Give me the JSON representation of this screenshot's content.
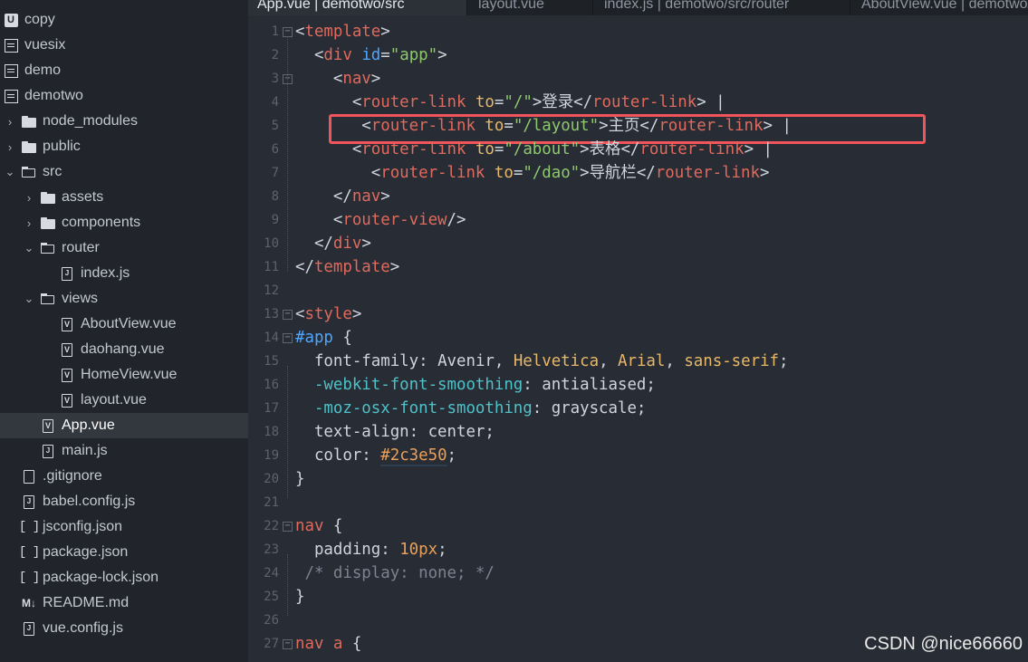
{
  "sidebar": {
    "items": [
      {
        "label": "copy",
        "icon": "project-u-icon",
        "indent": 0,
        "chevron": ""
      },
      {
        "label": "vuesix",
        "icon": "project-icon",
        "indent": 0,
        "chevron": ""
      },
      {
        "label": "demo",
        "icon": "project-icon",
        "indent": 0,
        "chevron": ""
      },
      {
        "label": "demotwo",
        "icon": "project-icon",
        "indent": 0,
        "chevron": ""
      },
      {
        "label": "node_modules",
        "icon": "folder-icon",
        "indent": 1,
        "chevron": "›"
      },
      {
        "label": "public",
        "icon": "folder-icon",
        "indent": 1,
        "chevron": "›"
      },
      {
        "label": "src",
        "icon": "folder-open-icon",
        "indent": 1,
        "chevron": "⌄"
      },
      {
        "label": "assets",
        "icon": "folder-icon",
        "indent": 2,
        "chevron": "›"
      },
      {
        "label": "components",
        "icon": "folder-icon",
        "indent": 2,
        "chevron": "›"
      },
      {
        "label": "router",
        "icon": "folder-open-icon",
        "indent": 2,
        "chevron": "⌄"
      },
      {
        "label": "index.js",
        "icon": "js-file-icon",
        "indent": 3,
        "chevron": ""
      },
      {
        "label": "views",
        "icon": "folder-open-icon",
        "indent": 2,
        "chevron": "⌄"
      },
      {
        "label": "AboutView.vue",
        "icon": "vue-file-icon",
        "indent": 3,
        "chevron": ""
      },
      {
        "label": "daohang.vue",
        "icon": "vue-file-icon",
        "indent": 3,
        "chevron": ""
      },
      {
        "label": "HomeView.vue",
        "icon": "vue-file-icon",
        "indent": 3,
        "chevron": ""
      },
      {
        "label": "layout.vue",
        "icon": "vue-file-icon",
        "indent": 3,
        "chevron": ""
      },
      {
        "label": "App.vue",
        "icon": "vue-file-icon",
        "indent": 2,
        "chevron": "",
        "selected": true
      },
      {
        "label": "main.js",
        "icon": "js-file-icon",
        "indent": 2,
        "chevron": ""
      },
      {
        "label": ".gitignore",
        "icon": "file-icon",
        "indent": 1,
        "chevron": ""
      },
      {
        "label": "babel.config.js",
        "icon": "js-file-icon",
        "indent": 1,
        "chevron": ""
      },
      {
        "label": "jsconfig.json",
        "icon": "json-file-icon",
        "indent": 1,
        "chevron": ""
      },
      {
        "label": "package.json",
        "icon": "json-file-icon",
        "indent": 1,
        "chevron": ""
      },
      {
        "label": "package-lock.json",
        "icon": "json-file-icon",
        "indent": 1,
        "chevron": ""
      },
      {
        "label": "README.md",
        "icon": "markdown-file-icon",
        "indent": 1,
        "chevron": ""
      },
      {
        "label": "vue.config.js",
        "icon": "js-file-icon",
        "indent": 1,
        "chevron": ""
      }
    ]
  },
  "tabs": [
    {
      "label": "App.vue | demotwo/src",
      "active": true
    },
    {
      "label": "layout.vue",
      "active": false
    },
    {
      "label": "index.js | demotwo/src/router",
      "active": false
    },
    {
      "label": "AboutView.vue | demotwo/src/views",
      "active": false
    }
  ],
  "editor": {
    "lines": [
      {
        "n": "1",
        "fold": "⊟",
        "tokens": [
          [
            "t-pun",
            "<"
          ],
          [
            "t-tag",
            "template"
          ],
          [
            "t-pun",
            ">"
          ]
        ]
      },
      {
        "n": "2",
        "fold": "",
        "tokens": [
          [
            "t-pun",
            "  <"
          ],
          [
            "t-tag",
            "div"
          ],
          [
            "t-pun",
            " "
          ],
          [
            "t-id",
            "id"
          ],
          [
            "t-pun",
            "="
          ],
          [
            "t-str",
            "\"app\""
          ],
          [
            "t-pun",
            ">"
          ]
        ]
      },
      {
        "n": "3",
        "fold": "⊟",
        "tokens": [
          [
            "t-pun",
            "    <"
          ],
          [
            "t-tag",
            "nav"
          ],
          [
            "t-pun",
            ">"
          ]
        ]
      },
      {
        "n": "4",
        "fold": "",
        "tokens": [
          [
            "t-pun",
            "      <"
          ],
          [
            "t-tag",
            "router-link"
          ],
          [
            "t-pun",
            " "
          ],
          [
            "t-attr",
            "to"
          ],
          [
            "t-pun",
            "="
          ],
          [
            "t-str",
            "\"/\""
          ],
          [
            "t-pun",
            ">"
          ],
          [
            "t-txt",
            "登录"
          ],
          [
            "t-pun",
            "</"
          ],
          [
            "t-tag",
            "router-link"
          ],
          [
            "t-pun",
            "> |"
          ]
        ]
      },
      {
        "n": "5",
        "fold": "",
        "tokens": [
          [
            "t-pun",
            "       <"
          ],
          [
            "t-tag",
            "router-link"
          ],
          [
            "t-pun",
            " "
          ],
          [
            "t-attr",
            "to"
          ],
          [
            "t-pun",
            "="
          ],
          [
            "t-str",
            "\"/layout\""
          ],
          [
            "t-pun",
            ">"
          ],
          [
            "t-txt",
            "主页"
          ],
          [
            "t-pun",
            "</"
          ],
          [
            "t-tag",
            "router-link"
          ],
          [
            "t-pun",
            "> |"
          ]
        ]
      },
      {
        "n": "6",
        "fold": "",
        "tokens": [
          [
            "t-pun",
            "      <"
          ],
          [
            "t-tag",
            "router-link"
          ],
          [
            "t-pun",
            " "
          ],
          [
            "t-attr",
            "to"
          ],
          [
            "t-pun",
            "="
          ],
          [
            "t-str",
            "\"/about\""
          ],
          [
            "t-pun",
            ">"
          ],
          [
            "t-txt",
            "表格"
          ],
          [
            "t-pun",
            "</"
          ],
          [
            "t-tag",
            "router-link"
          ],
          [
            "t-pun",
            "> |"
          ]
        ]
      },
      {
        "n": "7",
        "fold": "",
        "tokens": [
          [
            "t-pun",
            "        <"
          ],
          [
            "t-tag",
            "router-link"
          ],
          [
            "t-pun",
            " "
          ],
          [
            "t-attr",
            "to"
          ],
          [
            "t-pun",
            "="
          ],
          [
            "t-str",
            "\"/dao\""
          ],
          [
            "t-pun",
            ">"
          ],
          [
            "t-txt",
            "导航栏"
          ],
          [
            "t-pun",
            "</"
          ],
          [
            "t-tag",
            "router-link"
          ],
          [
            "t-pun",
            ">"
          ]
        ]
      },
      {
        "n": "8",
        "fold": "",
        "tokens": [
          [
            "t-pun",
            "    </"
          ],
          [
            "t-tag",
            "nav"
          ],
          [
            "t-pun",
            ">"
          ]
        ]
      },
      {
        "n": "9",
        "fold": "",
        "tokens": [
          [
            "t-pun",
            "    <"
          ],
          [
            "t-tag",
            "router-view"
          ],
          [
            "t-pun",
            "/>"
          ]
        ]
      },
      {
        "n": "10",
        "fold": "",
        "tokens": [
          [
            "t-pun",
            "  </"
          ],
          [
            "t-tag",
            "div"
          ],
          [
            "t-pun",
            ">"
          ]
        ]
      },
      {
        "n": "11",
        "fold": "",
        "tokens": [
          [
            "t-pun",
            "</"
          ],
          [
            "t-tag",
            "template"
          ],
          [
            "t-pun",
            ">"
          ]
        ]
      },
      {
        "n": "12",
        "fold": "",
        "tokens": []
      },
      {
        "n": "13",
        "fold": "⊟",
        "tokens": [
          [
            "t-pun",
            "<"
          ],
          [
            "t-tag",
            "style"
          ],
          [
            "t-pun",
            ">"
          ]
        ]
      },
      {
        "n": "14",
        "fold": "⊟",
        "tokens": [
          [
            "t-id",
            "#app"
          ],
          [
            "t-pun",
            " {"
          ]
        ]
      },
      {
        "n": "15",
        "fold": "",
        "tokens": [
          [
            "t-prop",
            "  font-family"
          ],
          [
            "t-pun",
            ": Avenir, "
          ],
          [
            "t-kw",
            "Helvetica"
          ],
          [
            "t-pun",
            ", "
          ],
          [
            "t-kw",
            "Arial"
          ],
          [
            "t-pun",
            ", "
          ],
          [
            "t-kw",
            "sans-serif"
          ],
          [
            "t-pun",
            ";"
          ]
        ]
      },
      {
        "n": "16",
        "fold": "",
        "tokens": [
          [
            "t-vprop",
            "  -webkit-font-smoothing"
          ],
          [
            "t-pun",
            ": antialiased;"
          ]
        ]
      },
      {
        "n": "17",
        "fold": "",
        "tokens": [
          [
            "t-vprop",
            "  -moz-osx-font-smoothing"
          ],
          [
            "t-pun",
            ": grayscale;"
          ]
        ]
      },
      {
        "n": "18",
        "fold": "",
        "tokens": [
          [
            "t-prop",
            "  text-align"
          ],
          [
            "t-pun",
            ": center;"
          ]
        ]
      },
      {
        "n": "19",
        "fold": "",
        "tokens": [
          [
            "t-prop",
            "  color"
          ],
          [
            "t-pun",
            ": "
          ],
          [
            "t-num swatch",
            "#2c3e50"
          ],
          [
            "t-pun",
            ";"
          ]
        ]
      },
      {
        "n": "20",
        "fold": "",
        "tokens": [
          [
            "t-pun",
            "}"
          ]
        ]
      },
      {
        "n": "21",
        "fold": "",
        "tokens": []
      },
      {
        "n": "22",
        "fold": "⊟",
        "tokens": [
          [
            "t-sel",
            "nav"
          ],
          [
            "t-pun",
            " {"
          ]
        ]
      },
      {
        "n": "23",
        "fold": "",
        "tokens": [
          [
            "t-prop",
            "  padding"
          ],
          [
            "t-pun",
            ": "
          ],
          [
            "t-num",
            "10px"
          ],
          [
            "t-pun",
            ";"
          ]
        ]
      },
      {
        "n": "24",
        "fold": "",
        "tokens": [
          [
            "t-cmt",
            " /* display: none; */"
          ]
        ]
      },
      {
        "n": "25",
        "fold": "",
        "tokens": [
          [
            "t-pun",
            "}"
          ]
        ]
      },
      {
        "n": "26",
        "fold": "",
        "tokens": []
      },
      {
        "n": "27",
        "fold": "⊟",
        "tokens": [
          [
            "t-sel",
            "nav a"
          ],
          [
            "t-pun",
            " {"
          ]
        ]
      }
    ]
  },
  "watermark": "CSDN @nice66660",
  "colors": {
    "highlight": "#f2545b",
    "selected_row": "#33373e",
    "editor_bg": "#282c34",
    "sidebar_bg": "#21252b"
  }
}
